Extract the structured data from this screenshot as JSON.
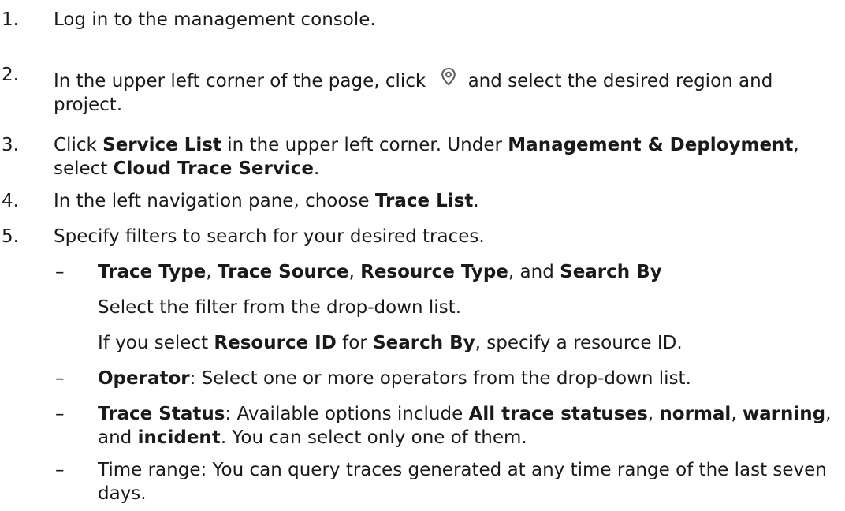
{
  "steps": [
    {
      "num": "1.",
      "segments": [
        {
          "t": "Log in to the management console."
        }
      ]
    },
    {
      "num": "2.",
      "segments": [
        {
          "t": "In the upper left corner of the page, click "
        },
        {
          "icon": "location-pin-icon"
        },
        {
          "t": "and select the desired region and project."
        }
      ]
    },
    {
      "num": "3.",
      "segments": [
        {
          "t": "Click "
        },
        {
          "t": "Service List",
          "b": true
        },
        {
          "t": " in the upper left corner. Under "
        },
        {
          "t": "Management & Deployment",
          "b": true
        },
        {
          "t": ", select "
        },
        {
          "t": "Cloud Trace Service",
          "b": true
        },
        {
          "t": "."
        }
      ]
    },
    {
      "num": "4.",
      "segments": [
        {
          "t": "In the left navigation pane, choose "
        },
        {
          "t": "Trace List",
          "b": true
        },
        {
          "t": "."
        }
      ]
    },
    {
      "num": "5.",
      "segments": [
        {
          "t": "Specify filters to search for your desired traces."
        }
      ]
    }
  ],
  "filters": [
    {
      "dash": "–",
      "segments": [
        {
          "t": "Trace Type",
          "b": true
        },
        {
          "t": ", "
        },
        {
          "t": "Trace Source",
          "b": true
        },
        {
          "t": ", "
        },
        {
          "t": "Resource Type",
          "b": true
        },
        {
          "t": ", and "
        },
        {
          "t": "Search By",
          "b": true
        }
      ],
      "paragraphs": [
        [
          {
            "t": "Select the filter from the drop-down list."
          }
        ],
        [
          {
            "t": "If you select "
          },
          {
            "t": "Resource ID",
            "b": true
          },
          {
            "t": " for "
          },
          {
            "t": "Search By",
            "b": true
          },
          {
            "t": ", specify a resource ID."
          }
        ]
      ]
    },
    {
      "dash": "–",
      "segments": [
        {
          "t": "Operator",
          "b": true
        },
        {
          "t": ": Select one or more operators from the drop-down list."
        }
      ]
    },
    {
      "dash": "–",
      "segments": [
        {
          "t": "Trace Status",
          "b": true
        },
        {
          "t": ": Available options include "
        },
        {
          "t": "All trace statuses",
          "b": true
        },
        {
          "t": ", "
        },
        {
          "t": "normal",
          "b": true
        },
        {
          "t": ", "
        },
        {
          "t": "warning",
          "b": true
        },
        {
          "t": ", and "
        },
        {
          "t": "incident",
          "b": true
        },
        {
          "t": ". You can select only one of them."
        }
      ]
    },
    {
      "dash": "–",
      "segments": [
        {
          "t": "Time range: You can query traces generated at any time range of the last seven days."
        }
      ]
    }
  ]
}
